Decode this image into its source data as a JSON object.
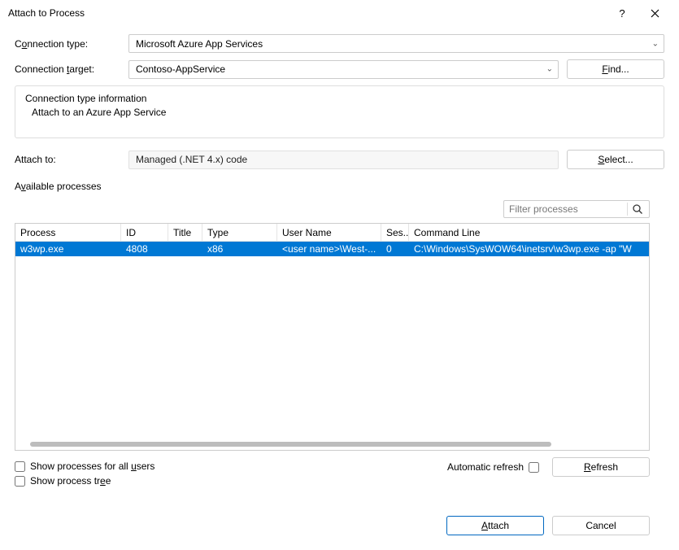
{
  "title": "Attach to Process",
  "labels": {
    "connection_type_pre": "C",
    "connection_type_u": "o",
    "connection_type_post": "nnection type:",
    "connection_target_pre": "Connection ",
    "connection_target_u": "t",
    "connection_target_post": "arget:",
    "attach_to": "Attach to:",
    "available_processes_pre": "A",
    "available_processes_u": "v",
    "available_processes_post": "ailable processes",
    "info_heading": "Connection type information",
    "info_body": "Attach to an Azure App Service"
  },
  "values": {
    "connection_type": "Microsoft Azure App Services",
    "connection_target": "Contoso-AppService",
    "attach_to": "Managed (.NET 4.x) code",
    "filter_placeholder": "Filter processes"
  },
  "buttons": {
    "find_pre": "",
    "find_u": "F",
    "find_post": "ind...",
    "select_pre": "",
    "select_u": "S",
    "select_post": "elect...",
    "refresh_pre": "",
    "refresh_u": "R",
    "refresh_post": "efresh",
    "attach_pre": "",
    "attach_u": "A",
    "attach_post": "ttach",
    "cancel": "Cancel"
  },
  "checks": {
    "all_users_pre": "Show processes for all ",
    "all_users_u": "u",
    "all_users_post": "sers",
    "tree_pre": "Show process tr",
    "tree_u": "e",
    "tree_post": "e",
    "auto_refresh": "Automatic refresh"
  },
  "table": {
    "headers": {
      "process": "Process",
      "id": "ID",
      "title": "Title",
      "type": "Type",
      "user": "User Name",
      "session": "Ses...",
      "cmd": "Command Line"
    },
    "rows": [
      {
        "process": "w3wp.exe",
        "id": "4808",
        "title": "",
        "type": "x86",
        "user": "<user name>\\West-...",
        "session": "0",
        "cmd": "C:\\Windows\\SysWOW64\\inetsrv\\w3wp.exe -ap \"W"
      }
    ]
  }
}
